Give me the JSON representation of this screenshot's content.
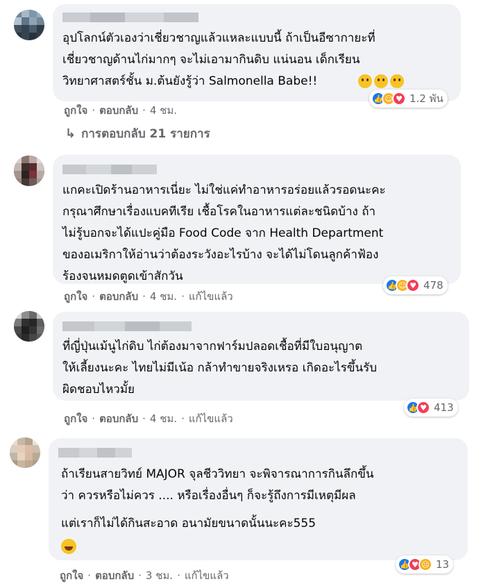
{
  "comments": [
    {
      "text": "อุปโลกน์ตัวเองว่าเชี่ยวชาญแล้วแหละแบบนี้ ถ้าเป็นอีซากายะที่\nเชี่ยวชาญด้านไก่มากๆ จะไม่เอามากินดิบ แน่นอน เด็กเรียน\nวิทยาศาสตร์ชั้น ม.ต้นยังรู้ว่า Salmonella Babe!!",
      "trailing_emojis": "thinking-face-emoji x3",
      "reactions": [
        "like",
        "haha",
        "love"
      ],
      "reaction_count": "1.2 พัน",
      "like_label": "ถูกใจ",
      "reply_label": "ตอบกลับ",
      "time": "4 ชม.",
      "edited": "",
      "replies": "การตอบกลับ 21 รายการ"
    },
    {
      "text": "แกคะเปิดร้านอาหารเนี่ยะ ไม่ใช่แค่ทำอาหารอร่อยแล้วรอดนะคะ\nกรุณาศึกษาเรื่องแบคทีเรีย เชื้อโรคในอาหารแต่ละชนิดบ้าง ถ้า\nไม่รู้บอกจะได้แปะคู่มือ Food Code จาก Health Department\nของอเมริกาให้อ่านว่าต้องระวังอะไรบ้าง จะได้ไม่โดนลูกค้าฟ้อง\nร้องจนหมดตูดเข้าสักวัน",
      "reactions": [
        "like",
        "haha",
        "love"
      ],
      "reaction_count": "478",
      "like_label": "ถูกใจ",
      "reply_label": "ตอบกลับ",
      "time": "4 ชม.",
      "edited": "แก้ไขแล้ว"
    },
    {
      "text": "ที่ญี่ปุ่นเม้นูไก่ดิบ ไก่ต้องมาจากฟาร์มปลอดเชื้อที่มีใบอนุญาต\nให้เลี้ยงนะคะ ไทยไม่มีเน้อ กล้าทำขายจริงเหรอ เกิดอะไรขึ้นรับ\nผิดชอบไหวมั้ย",
      "reactions": [
        "like",
        "love"
      ],
      "reaction_count": "413",
      "like_label": "ถูกใจ",
      "reply_label": "ตอบกลับ",
      "time": "4 ชม.",
      "edited": "แก้ไขแล้ว"
    },
    {
      "text": "ถ้าเรียนสายวิทย์ MAJOR จุลชีววิทยา จะพิจารณาการกินลึกขึ้น\nว่า ควรหรือไม่ควร .... หรือเรื่องอื่นๆ ก็จะรู้ถึงการมีเหตุมีผล",
      "text2": "แต่เราก็ไม่ได้กินสะอาด อนามัยขนาดนั้นนะคะ555",
      "trailing_emoji": "grinning-face-emoji",
      "reactions": [
        "like",
        "love",
        "sad"
      ],
      "reaction_count": "13",
      "like_label": "ถูกใจ",
      "reply_label": "ตอบกลับ",
      "time": "3 ชม.",
      "edited": "แก้ไขแล้ว"
    }
  ],
  "colors": {
    "bubble": "#f0f2f5",
    "secondary_text": "#65676b",
    "like_blue": "#1877f2",
    "love_red": "#f33e58",
    "haha_yellow": "#f7b125"
  }
}
